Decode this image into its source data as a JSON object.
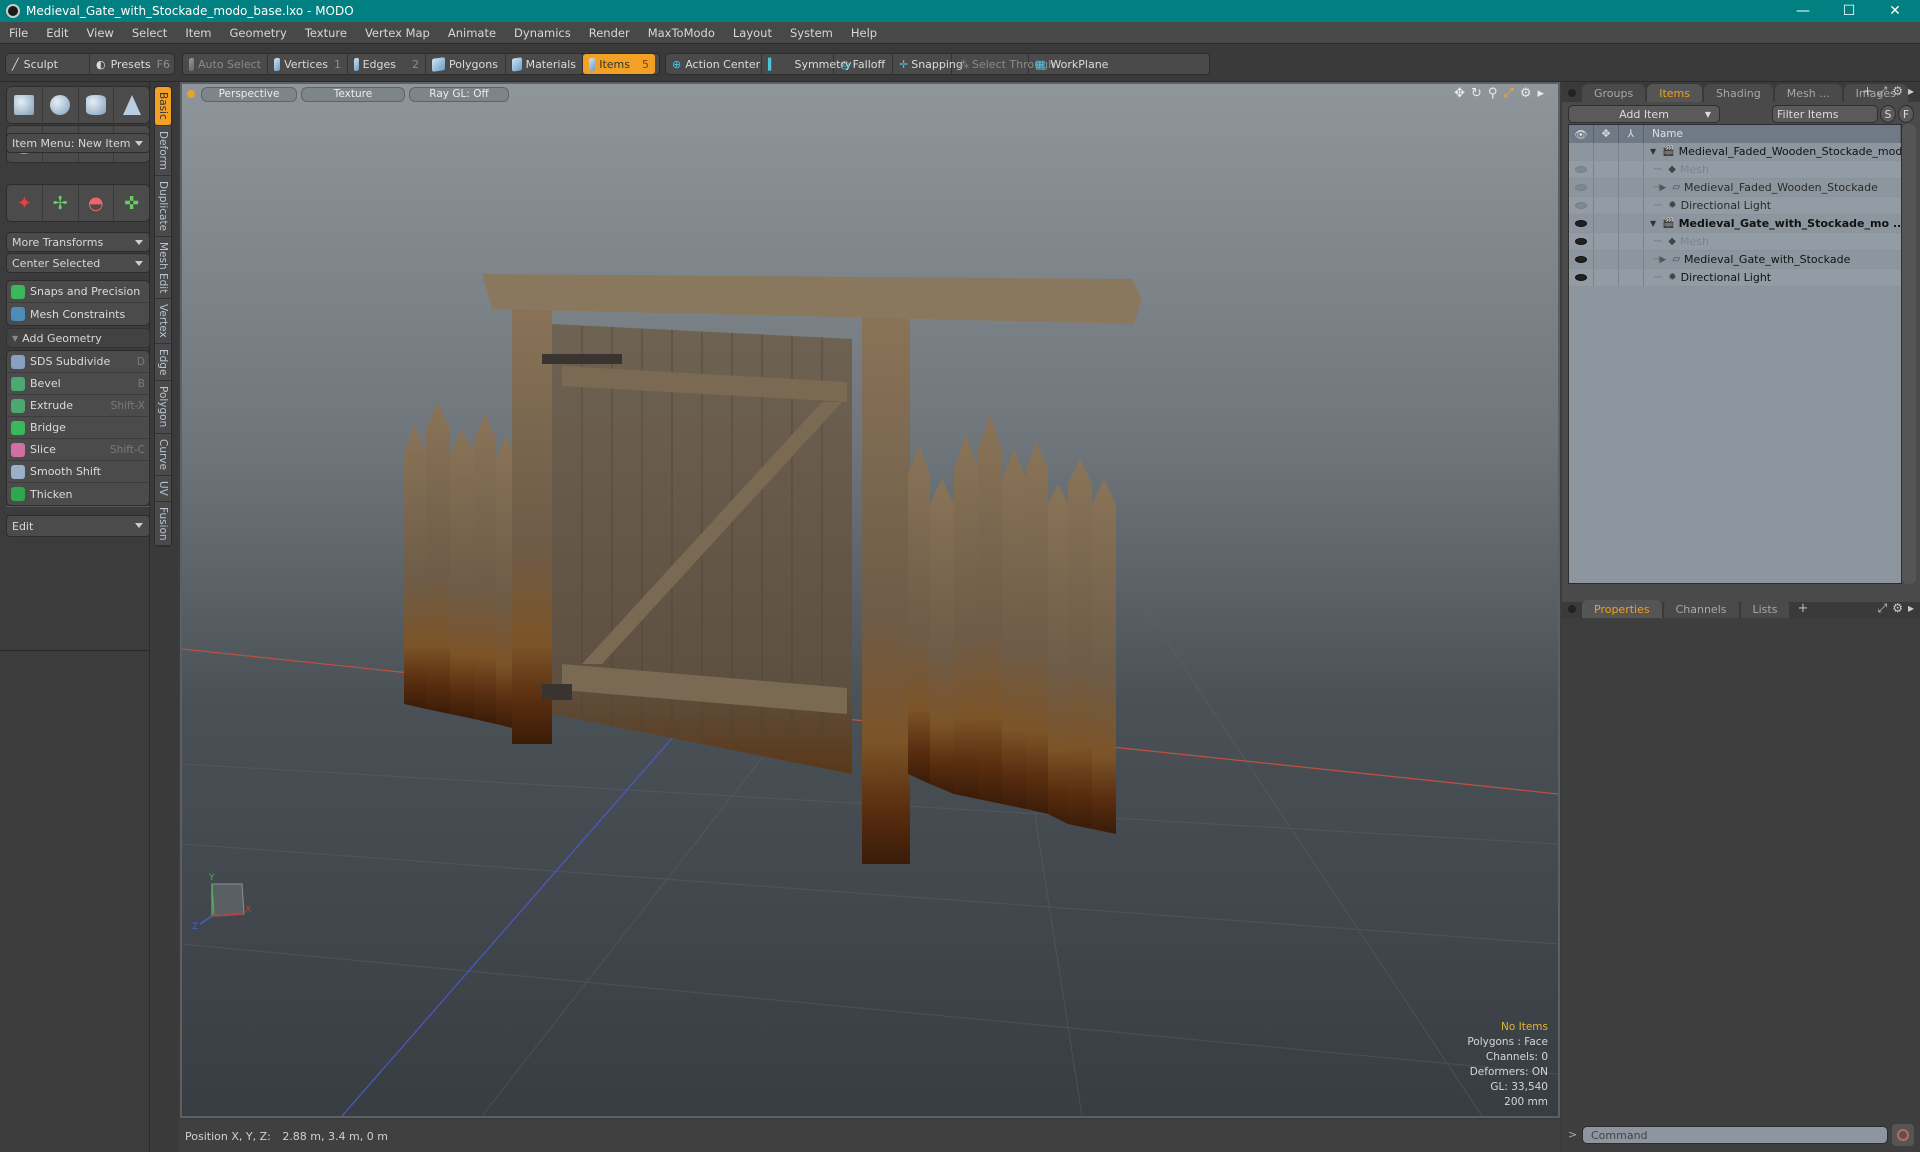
{
  "window": {
    "title": "Medieval_Gate_with_Stockade_modo_base.lxo - MODO",
    "controls": {
      "minimize": "—",
      "maximize": "☐",
      "close": "✕"
    }
  },
  "menubar": [
    "File",
    "Edit",
    "View",
    "Select",
    "Item",
    "Geometry",
    "Texture",
    "Vertex Map",
    "Animate",
    "Dynamics",
    "Render",
    "MaxToModo",
    "Layout",
    "System",
    "Help"
  ],
  "toolbar": {
    "sculpt": "Sculpt",
    "presets": "Presets",
    "presets_key": "F6",
    "auto_select": "Auto Select",
    "vertices": "Vertices",
    "vertices_key": "1",
    "edges": "Edges",
    "edges_key": "2",
    "polygons": "Polygons",
    "materials": "Materials",
    "items": "Items",
    "items_key": "5",
    "action_center": "Action Center",
    "symmetry": "Symmetry",
    "falloff": "Falloff",
    "snapping": "Snapping",
    "select_through": "Select Through",
    "workplane": "WorkPlane"
  },
  "left_panel": {
    "item_menu": "Item Menu: New Item",
    "more_transforms": "More Transforms",
    "center_selected": "Center Selected",
    "snaps": "Snaps and Precision",
    "mesh_constraints": "Mesh Constraints",
    "add_geometry": "Add Geometry",
    "tools": [
      {
        "label": "SDS Subdivide",
        "shortcut": "D",
        "color": "#8aa0c0"
      },
      {
        "label": "Bevel",
        "shortcut": "B",
        "color": "#4aa870"
      },
      {
        "label": "Extrude",
        "shortcut": "Shift-X",
        "color": "#4aa870"
      },
      {
        "label": "Bridge",
        "shortcut": "",
        "color": "#3cb85c"
      },
      {
        "label": "Slice",
        "shortcut": "Shift-C",
        "color": "#d070a0"
      },
      {
        "label": "Smooth Shift",
        "shortcut": "",
        "color": "#9ab0c8"
      },
      {
        "label": "Thicken",
        "shortcut": "",
        "color": "#2ea84c"
      }
    ],
    "edit": "Edit",
    "vtabs": [
      "Basic",
      "Deform",
      "Duplicate",
      "Mesh Edit",
      "Vertex",
      "Edge",
      "Polygon",
      "Curve",
      "UV",
      "Fusion"
    ]
  },
  "viewport": {
    "view": "Perspective",
    "shading": "Texture",
    "raygl": "Ray GL: Off",
    "hud": {
      "selection": "No Items",
      "polygons": "Polygons : Face",
      "channels": "Channels: 0",
      "deformers": "Deformers: ON",
      "gl": "GL: 33,540",
      "scale": "200 mm"
    },
    "axis": {
      "x": "X",
      "y": "Y",
      "z": "Z"
    }
  },
  "statusbar": {
    "position_label": "Position X, Y, Z:",
    "position_value": "2.88 m, 3.4 m, 0 m"
  },
  "right_panel": {
    "tabs": [
      "Groups",
      "Items",
      "Shading",
      "Mesh ...",
      "Images"
    ],
    "active_tab": "Items",
    "add_item": "Add Item",
    "filter_placeholder": "Filter Items",
    "s_btn": "S",
    "f_btn": "F",
    "col_name": "Name",
    "items": [
      {
        "name": "Medieval_Faded_Wooden_Stockade_modo ...",
        "type": "scene",
        "level": 0,
        "visible": false,
        "bold": false
      },
      {
        "name": "Mesh",
        "type": "mesh",
        "level": 1,
        "visible": true,
        "dim": true
      },
      {
        "name": "Medieval_Faded_Wooden_Stockade",
        "type": "group",
        "level": 1,
        "visible": true,
        "dim": true
      },
      {
        "name": "Directional Light",
        "type": "light",
        "level": 1,
        "visible": true,
        "dim": true
      },
      {
        "name": "Medieval_Gate_with_Stockade_mo ...",
        "type": "scene",
        "level": 0,
        "visible": true,
        "bold": true
      },
      {
        "name": "Mesh",
        "type": "mesh",
        "level": 1,
        "visible": true
      },
      {
        "name": "Medieval_Gate_with_Stockade",
        "type": "group",
        "level": 1,
        "visible": true
      },
      {
        "name": "Directional Light",
        "type": "light",
        "level": 1,
        "visible": true
      }
    ],
    "bottom_tabs": [
      "Properties",
      "Channels",
      "Lists"
    ],
    "bottom_active": "Properties",
    "command_placeholder": "Command"
  }
}
